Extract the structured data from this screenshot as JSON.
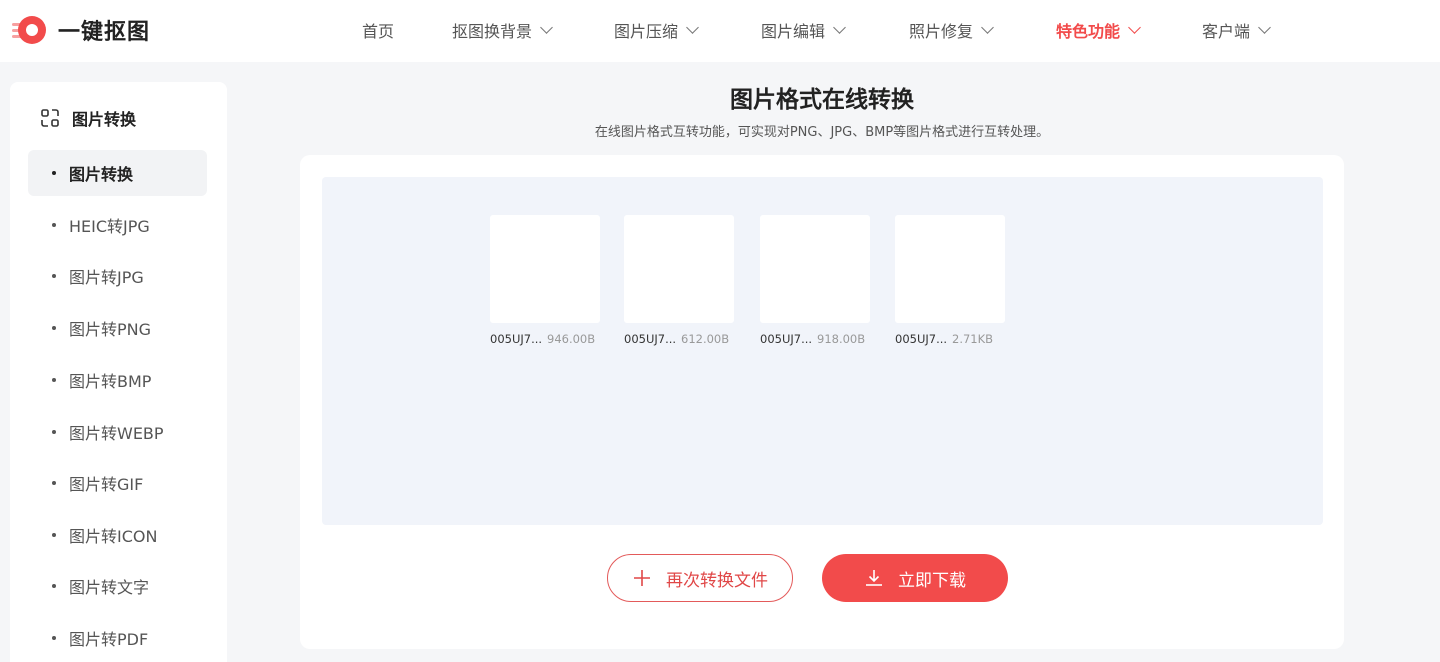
{
  "header": {
    "logo_text": "一键抠图",
    "nav": [
      {
        "label": "首页",
        "dropdown": false,
        "active": false
      },
      {
        "label": "抠图换背景",
        "dropdown": true,
        "active": false
      },
      {
        "label": "图片压缩",
        "dropdown": true,
        "active": false
      },
      {
        "label": "图片编辑",
        "dropdown": true,
        "active": false
      },
      {
        "label": "照片修复",
        "dropdown": true,
        "active": false
      },
      {
        "label": "特色功能",
        "dropdown": true,
        "active": true
      },
      {
        "label": "客户端",
        "dropdown": true,
        "active": false
      }
    ]
  },
  "sidebar": {
    "title": "图片转换",
    "items": [
      {
        "label": "图片转换",
        "active": true
      },
      {
        "label": "HEIC转JPG",
        "active": false
      },
      {
        "label": "图片转JPG",
        "active": false
      },
      {
        "label": "图片转PNG",
        "active": false
      },
      {
        "label": "图片转BMP",
        "active": false
      },
      {
        "label": "图片转WEBP",
        "active": false
      },
      {
        "label": "图片转GIF",
        "active": false
      },
      {
        "label": "图片转ICON",
        "active": false
      },
      {
        "label": "图片转文字",
        "active": false
      },
      {
        "label": "图片转PDF",
        "active": false
      }
    ]
  },
  "main": {
    "title": "图片格式在线转换",
    "subtitle": "在线图片格式互转功能，可实现对PNG、JPG、BMP等图片格式进行互转处理。",
    "files": [
      {
        "name": "005UJ7...",
        "size": "946.00B"
      },
      {
        "name": "005UJ7...",
        "size": "612.00B"
      },
      {
        "name": "005UJ7...",
        "size": "918.00B"
      },
      {
        "name": "005UJ7...",
        "size": "2.71KB"
      }
    ],
    "reconvert_label": "再次转换文件",
    "download_label": "立即下载"
  },
  "colors": {
    "accent": "#f24b4b",
    "bg": "#f5f6f8",
    "dropzone": "#f1f4fa"
  }
}
